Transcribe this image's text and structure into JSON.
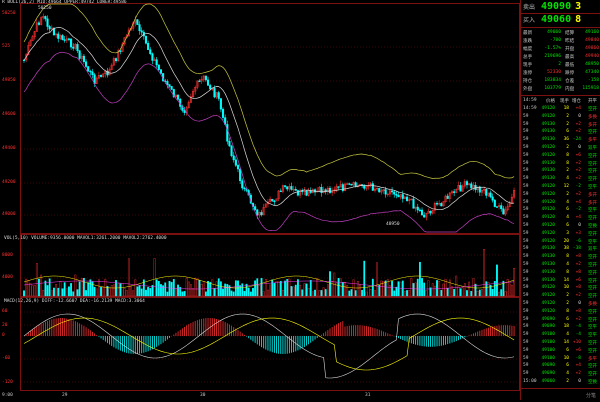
{
  "symbol_header": {
    "code": "R",
    "line": "R  BOLL(26,2) MID:49664 UPPER:49742 LOWER:49586"
  },
  "price_axis": [
    "50250",
    "525",
    "49850",
    "49600",
    "49400",
    "49200",
    "49000"
  ],
  "hi_label": "50250",
  "lo_label": "48950",
  "vol_title": "VOL(5,10) VOLUME:9356.0000  MAVOL1:3261.2000  MAVOL2:2762.4000",
  "vol_axis": [
    "8000",
    "4000"
  ],
  "macd_title": "MACD(12,26,9) DIFF:-12.6607  DEA:-16.2139  MACD:3.3064",
  "macd_axis": [
    "60",
    "20",
    "0",
    "-60",
    "-120"
  ],
  "x_labels": [
    "9:00",
    "29",
    "30",
    "31"
  ],
  "side": {
    "sell_label": "卖出",
    "sell_price": "49090",
    "sell_qty": "3",
    "buy_label": "买入",
    "buy_price": "49060",
    "buy_qty": "8",
    "stats": [
      {
        "k1": "最新",
        "v1": "49060",
        "k2": "结算",
        "v2": "49160"
      },
      {
        "k1": "涨跌",
        "v1": "-780",
        "k2": "昨结",
        "v2": "49840"
      },
      {
        "k1": "幅度",
        "v1": "-1.57%",
        "k2": "开盘",
        "v2": "49860"
      },
      {
        "k1": "总手",
        "v1": "219696",
        "k2": "最高",
        "v2": "49940"
      },
      {
        "k1": "现手",
        "v1": "2",
        "k2": "最低",
        "v2": "48950"
      },
      {
        "k1": "涨停",
        "v1": "52330",
        "k2": "跌停",
        "v2": "47340"
      },
      {
        "k1": "持仓",
        "v1": "183834",
        "k2": "仓差",
        "v2": "-158"
      },
      {
        "k1": "外盘",
        "v1": "103779",
        "k2": "内盘",
        "v2": "115918"
      }
    ],
    "tick_header": [
      "14:59",
      "价格",
      "现手",
      "增仓",
      "开平"
    ],
    "ticks": [
      {
        "t": "14:59",
        "p": "49120",
        "q": "18",
        "d": "+4",
        "o": "空开"
      },
      {
        "t": "59",
        "p": "49120",
        "q": "2",
        "d": "0",
        "o": "多换"
      },
      {
        "t": "59",
        "p": "49130",
        "q": "2",
        "d": "+2",
        "o": "多开"
      },
      {
        "t": "59",
        "p": "49130",
        "q": "6",
        "d": "+2",
        "o": "空开"
      },
      {
        "t": "59",
        "p": "49130",
        "q": "36",
        "d": "-24",
        "o": "多平"
      },
      {
        "t": "59",
        "p": "49120",
        "q": "2",
        "d": "0",
        "o": "双平"
      },
      {
        "t": "59",
        "p": "49120",
        "q": "8",
        "d": "+6",
        "o": "空开"
      },
      {
        "t": "59",
        "p": "49130",
        "q": "8",
        "d": "+2",
        "o": "空开"
      },
      {
        "t": "59",
        "p": "49130",
        "q": "2",
        "d": "+2",
        "o": "空开"
      },
      {
        "t": "59",
        "p": "49130",
        "q": "4",
        "d": "+2",
        "o": "空开"
      },
      {
        "t": "59",
        "p": "49120",
        "q": "12",
        "d": "-2",
        "o": "空平"
      },
      {
        "t": "59",
        "p": "49120",
        "q": "2",
        "d": "+2",
        "o": "多开"
      },
      {
        "t": "59",
        "p": "49120",
        "q": "4",
        "d": "+4",
        "o": "多开"
      },
      {
        "t": "59",
        "p": "49120",
        "q": "6",
        "d": "-2",
        "o": "空平"
      },
      {
        "t": "59",
        "p": "49120",
        "q": "4",
        "d": "+4",
        "o": "空开"
      },
      {
        "t": "59",
        "p": "49120",
        "q": "6",
        "d": "0",
        "o": "空换"
      },
      {
        "t": "59",
        "p": "49120",
        "q": "3",
        "d": "+3",
        "o": "空开"
      },
      {
        "t": "59",
        "p": "49120",
        "q": "20",
        "d": "-6",
        "o": "空平"
      },
      {
        "t": "59",
        "p": "49130",
        "q": "38",
        "d": "-38",
        "o": "双平"
      },
      {
        "t": "59",
        "p": "49130",
        "q": "8",
        "d": "+8",
        "o": "空开"
      },
      {
        "t": "59",
        "p": "49130",
        "q": "4",
        "d": "+2",
        "o": "空开"
      },
      {
        "t": "59",
        "p": "49130",
        "q": "8",
        "d": "+8",
        "o": "空开"
      },
      {
        "t": "59",
        "p": "49130",
        "q": "14",
        "d": "+6",
        "o": "空开"
      },
      {
        "t": "59",
        "p": "49120",
        "q": "10",
        "d": "+8",
        "o": "空开"
      },
      {
        "t": "59",
        "p": "49120",
        "q": "2",
        "d": "+2",
        "o": "空开"
      },
      {
        "t": "59",
        "p": "49120",
        "q": "2",
        "d": "0",
        "o": "多换"
      },
      {
        "t": "59",
        "p": "49120",
        "q": "8",
        "d": "+8",
        "o": "空开"
      },
      {
        "t": "59",
        "p": "49090",
        "q": "6",
        "d": "+2",
        "o": "空开"
      },
      {
        "t": "59",
        "p": "49090",
        "q": "18",
        "d": "-4",
        "o": "空平"
      },
      {
        "t": "59",
        "p": "49100",
        "q": "4",
        "d": "-4",
        "o": "空平"
      },
      {
        "t": "59",
        "p": "49100",
        "q": "14",
        "d": "+10",
        "o": "空开"
      },
      {
        "t": "59",
        "p": "49100",
        "q": "6",
        "d": "+6",
        "o": "空开"
      },
      {
        "t": "59",
        "p": "49100",
        "q": "10",
        "d": "-8",
        "o": "多平"
      },
      {
        "t": "59",
        "p": "49090",
        "q": "6",
        "d": "+4",
        "o": "空开"
      },
      {
        "t": "59",
        "p": "49090",
        "q": "4",
        "d": "+2",
        "o": "空开"
      },
      {
        "t": "15:00",
        "p": "49060",
        "q": "2",
        "d": "0",
        "o": "空换"
      }
    ]
  },
  "tab_hint": "分笔",
  "colors": {
    "up": "#ff3030",
    "down": "#00ffff",
    "mid": "#ffff00",
    "boll_upper": "#c8c840",
    "boll_lower": "#c040c0",
    "frame": "#7a1010"
  }
}
